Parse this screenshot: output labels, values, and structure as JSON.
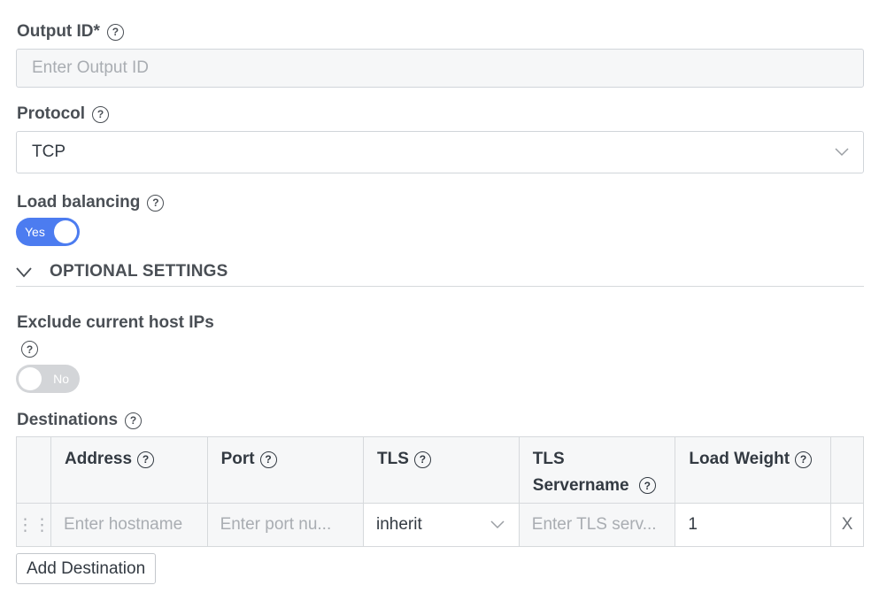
{
  "output_id": {
    "label": "Output ID*",
    "placeholder": "Enter Output ID",
    "value": ""
  },
  "protocol": {
    "label": "Protocol",
    "value": "TCP"
  },
  "load_balancing": {
    "label": "Load balancing",
    "state": "Yes",
    "enabled": true
  },
  "optional_settings": {
    "label": "OPTIONAL SETTINGS",
    "expanded": true
  },
  "exclude_host_ips": {
    "label": "Exclude current host IPs",
    "state": "No",
    "enabled": false
  },
  "destinations": {
    "label": "Destinations",
    "columns": [
      "Address",
      "Port",
      "TLS",
      "TLS Servername",
      "Load Weight"
    ],
    "rows": [
      {
        "address_placeholder": "Enter hostname",
        "port_placeholder": "Enter port nu...",
        "tls_value": "inherit",
        "tls_servername_placeholder": "Enter TLS serv...",
        "load_weight": "1",
        "remove_label": "X"
      }
    ],
    "add_button_label": "Add Destination"
  },
  "icons": {
    "help": "question-circle-icon",
    "dropdown": "chevron-down-icon",
    "drag": "drag-handle-icon",
    "remove": "close-icon"
  },
  "colors": {
    "toggle_on": "#4c7cf0",
    "toggle_off": "#d3d5d8"
  }
}
